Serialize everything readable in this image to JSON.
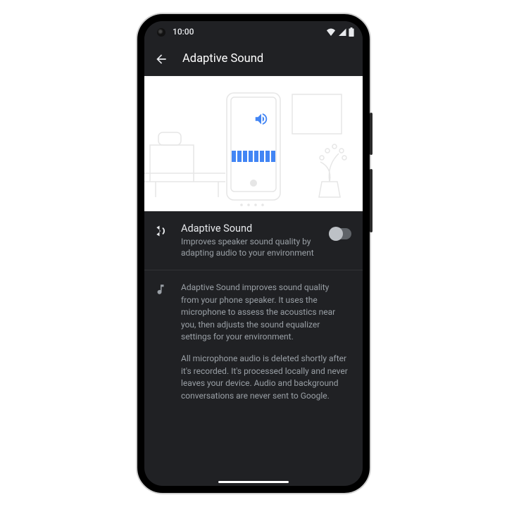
{
  "statusbar": {
    "time": "10:00"
  },
  "appbar": {
    "title": "Adaptive Sound"
  },
  "setting": {
    "title": "Adaptive Sound",
    "subtitle": "Improves speaker sound quality by adapting audio to your environment",
    "enabled": false
  },
  "info": {
    "p1": "Adaptive Sound improves sound quality from your phone speaker. It uses the microphone to assess the acoustics near you, then adjusts the sound equalizer settings for your environment.",
    "p2": "All microphone audio is deleted shortly after it's recorded. It's processed locally and never leaves your device. Audio and background conversations are never sent to Google."
  },
  "illustration": {
    "eq_bars": 8,
    "accent": "#4285f4"
  }
}
